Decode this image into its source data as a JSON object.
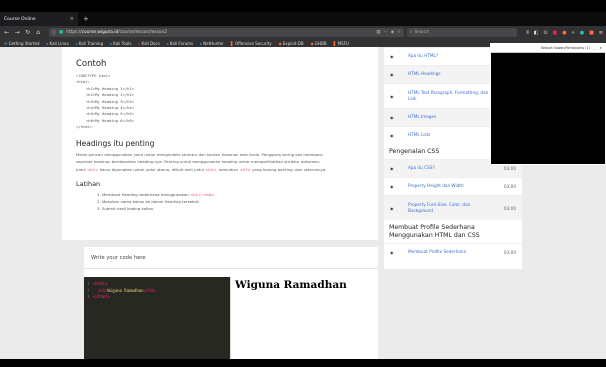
{
  "browser": {
    "tab_title": "Course Online",
    "tab_close": "×",
    "new_tab": "+",
    "url_protocol": "https://",
    "url_host": "course.wiguna.id",
    "url_path": "/course/lesson/lesson2",
    "search_placeholder": "Search",
    "bookmarks": [
      "Getting Started",
      "Kali Linux",
      "Kali Training",
      "Kali Tools",
      "Kali Docs",
      "Kali Forums",
      "NetHunter",
      "Offensive Security",
      "Exploit-DB",
      "GHDB",
      "MSFU"
    ]
  },
  "lesson": {
    "example_heading": "Contoh",
    "code_lines": [
      {
        "text": "<!DOCTYPE html>",
        "indent": false
      },
      {
        "text": "<html>",
        "indent": false
      },
      {
        "text": "<h1>My Heading 1</h1>",
        "indent": true
      },
      {
        "text": "<h2>My Heading 2</h2>",
        "indent": true
      },
      {
        "text": "<h3>My Heading 3</h3>",
        "indent": true
      },
      {
        "text": "<h4>My Heading 4</h4>",
        "indent": true
      },
      {
        "text": "<h5>My Heading 5</h5>",
        "indent": true
      },
      {
        "text": "<h6>My Heading 6</h6>",
        "indent": true
      },
      {
        "text": "</html>",
        "indent": false
      }
    ],
    "importance_heading": "Headings itu penting",
    "paragraph_1": "Mesin pencari menggunakan judul untuk mengindeks struktur dan konten halaman web Anda. Pengguna sering kali membaca",
    "paragraph_2a": "sepintas halaman berdasarkan heading-nya. Penting untuk menggunakan ",
    "paragraph_2_em": "heading",
    "paragraph_2b": " untuk memperlihatkan struktur dokumen.",
    "paragraph_3a": "Judul ",
    "paragraph_3_code1": "<h1>",
    "paragraph_3b": " harus digunakan untuk judul utama, diikuti oleh judul ",
    "paragraph_3_code2": "<h2>",
    "paragraph_3c": ", kemudian ",
    "paragraph_3_code3": "<h3>",
    "paragraph_3d": " yang kurang penting, dan seterusnya.",
    "exercise_heading": "Latihan",
    "task_1a": "1. Membuat Heading sederhana menggunakan ",
    "task_1_code": "<h1>-<h6>",
    "task_1b": ".",
    "task_2": "2. Masukan nama kalian ke dalam Heading tersebut.",
    "task_3": "3. Submit hasil koding kalian."
  },
  "editor": {
    "title": "Write your code here",
    "lines": [
      {
        "num": "1",
        "open": "<html>",
        "text": "",
        "close": ""
      },
      {
        "num": "2",
        "open": "  <h1>",
        "text": "Wiguna Ramadhan",
        "close": "</h1>"
      },
      {
        "num": "3",
        "open": "</html>",
        "text": "",
        "close": ""
      }
    ],
    "preview_text": "Wiguna Ramadhan"
  },
  "syllabus": {
    "items_top": [
      {
        "label": "Apa itu HTML?",
        "duration": "03:00",
        "tall": false
      },
      {
        "label": "HTML Headings",
        "duration": "03:00",
        "tall": false
      },
      {
        "label": "HTML Text Paragraph, Formatting, dan Link",
        "duration": "03:00",
        "tall": true
      },
      {
        "label": "HTML Images",
        "duration": "03:00",
        "tall": false
      },
      {
        "label": "HTML Lists",
        "duration": "03:00",
        "tall": false
      }
    ],
    "section_css": "Pengenalan CSS",
    "items_css": [
      {
        "label": "Apa itu CSS?",
        "duration": "03:00",
        "tall": false
      },
      {
        "label": "Property Height dan Width",
        "duration": "03:00",
        "tall": false
      },
      {
        "label": "Property Font-Size, Color, dan Background",
        "duration": "03:00",
        "tall": true
      }
    ],
    "section_profile": "Membuat Profile Sederhana Menggunakan HTML dan CSS",
    "items_profile": [
      {
        "label": "Membuat Profile Sederhana",
        "duration": "03:00",
        "tall": false
      }
    ]
  },
  "overlay": {
    "title": "Sebuah Sawan/Participants (1)",
    "minimize": "_",
    "close": "×"
  }
}
